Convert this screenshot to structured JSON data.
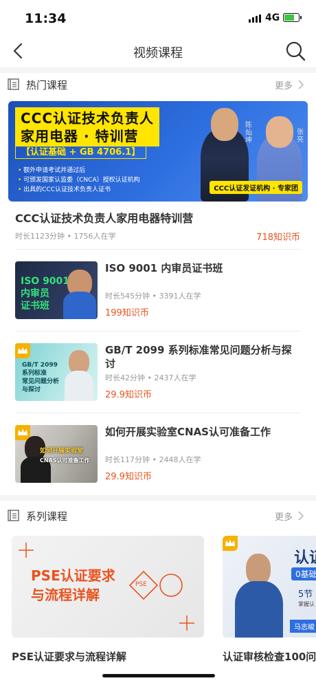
{
  "status_bar": {
    "time": "11:34",
    "network": "4G"
  },
  "nav": {
    "title": "视频课程"
  },
  "hot_section": {
    "label": "热门课程",
    "more": "更多"
  },
  "banner": {
    "headline_line1": "CCC认证技术负责人",
    "headline_line2": "家用电器 · 特训营",
    "subtitle": "【认证基础 + GB 4706.1】",
    "bullets": [
      "额外申请考试并通过后",
      "可颁发国家认监委（CNCA）授权认证机构",
      "出具的CCC认证技术负责人证书"
    ],
    "names": [
      "陈灿坤",
      "张亮"
    ],
    "tag": "CCC认证发证机构 · 专家团"
  },
  "featured": {
    "title": "CCC认证技术负责人家用电器特训营",
    "meta": "时长1123分钟 • 1756人在学",
    "price": "718知识币"
  },
  "courses": [
    {
      "title": "ISO 9001 内审员证书班",
      "meta": "时长545分钟 • 3391人在学",
      "price": "199知识币",
      "thumb_text": [
        "ISO 9001",
        "内审员",
        "证书班"
      ]
    },
    {
      "title": "GB/T 2099 系列标准常见问题分析与探讨",
      "meta": "时长42分钟 • 2437人在学",
      "price": "29.9知识币",
      "thumb_text": [
        "GB/T 2099",
        "系列标准",
        "常见问题分析",
        "与探讨"
      ]
    },
    {
      "title": "如何开展实验室CNAS认可准备工作",
      "meta": "时长117分钟 • 2448人在学",
      "price": "29.9知识币",
      "thumb_text": [
        "如何开展实验室",
        "CNAS认可准备工作"
      ]
    }
  ],
  "series_section": {
    "label": "系列课程",
    "more": "更多"
  },
  "series": [
    {
      "title": "PSE认证要求与流程详解",
      "thumb_line1": "PSE认证要求",
      "thumb_line2": "与流程详解",
      "badge": "PSE"
    },
    {
      "title": "认证审核检查100问",
      "thumb_title": "认证",
      "thumb_sub": "0基础",
      "thumb_count": "5节",
      "thumb_note": "掌握认",
      "thumb_name": "马志峻"
    }
  ],
  "colors": {
    "accent": "#e9531f",
    "banner_blue": "#2e6fe0",
    "banner_yellow": "#ffe500",
    "crown": "#f5b200"
  }
}
